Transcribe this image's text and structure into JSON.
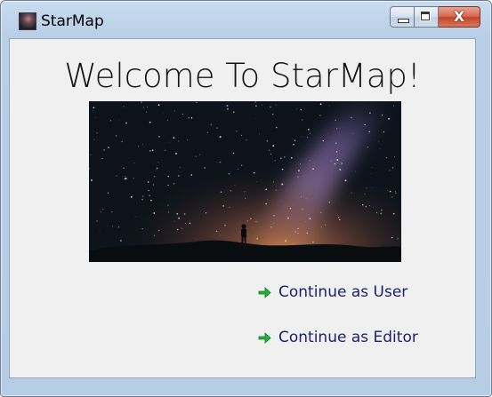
{
  "window": {
    "title": "StarMap",
    "close_symbol": "X",
    "icons": [
      "app-icon",
      "minimize-icon",
      "maximize-icon",
      "close-icon"
    ]
  },
  "main": {
    "heading": "Welcome To StarMap!",
    "image_alt": "starry sky",
    "actions": [
      {
        "label": "Continue as User",
        "icon": "green-arrow-icon"
      },
      {
        "label": "Continue as Editor",
        "icon": "green-arrow-icon"
      }
    ]
  },
  "colors": {
    "link": "#1a1f6e",
    "arrow": "#1fb23b",
    "client_bg": "#f0f0f0"
  }
}
